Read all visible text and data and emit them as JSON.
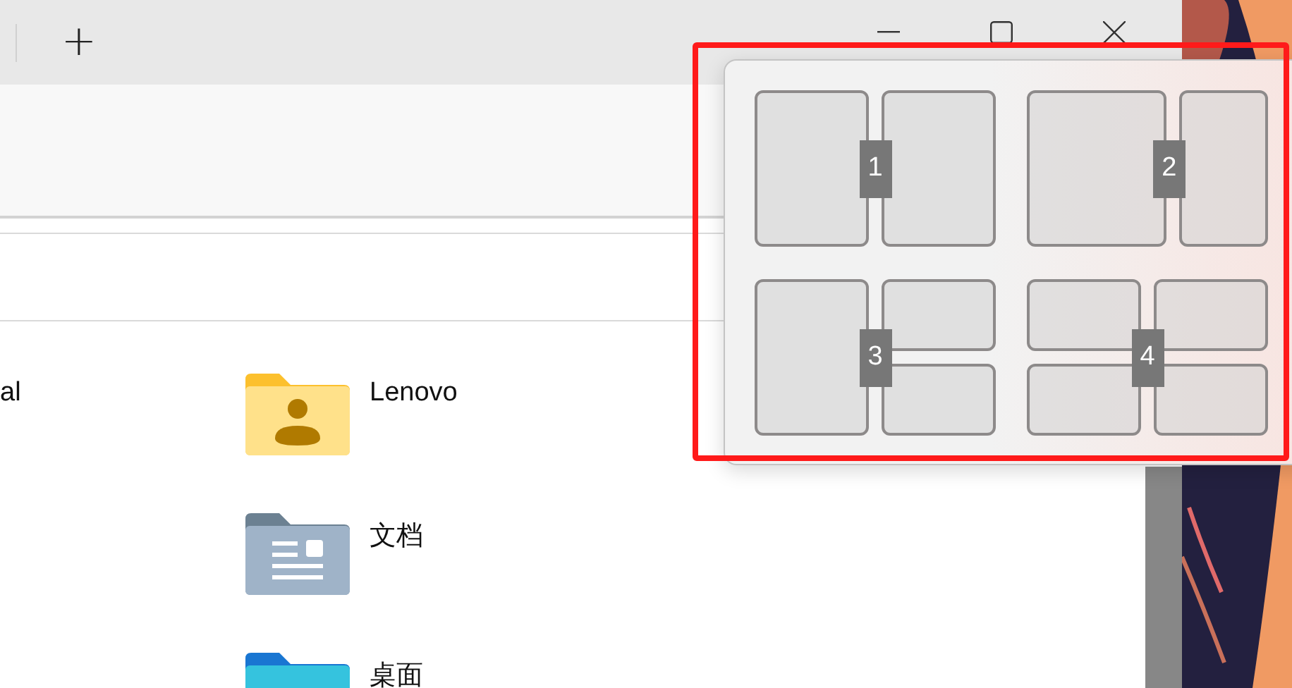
{
  "title_bar": {
    "new_tab": "+"
  },
  "files": [
    {
      "name": "al",
      "kind": "plain"
    },
    {
      "name": "Lenovo",
      "kind": "user"
    },
    {
      "name": "文档",
      "kind": "documents"
    },
    {
      "name": "桌面",
      "kind": "desktop"
    }
  ],
  "snap_layouts": [
    {
      "number": "1",
      "kind": "halves"
    },
    {
      "number": "2",
      "kind": "wide-left"
    },
    {
      "number": "3",
      "kind": "left-stacked-right"
    },
    {
      "number": "4",
      "kind": "quadrants"
    }
  ]
}
